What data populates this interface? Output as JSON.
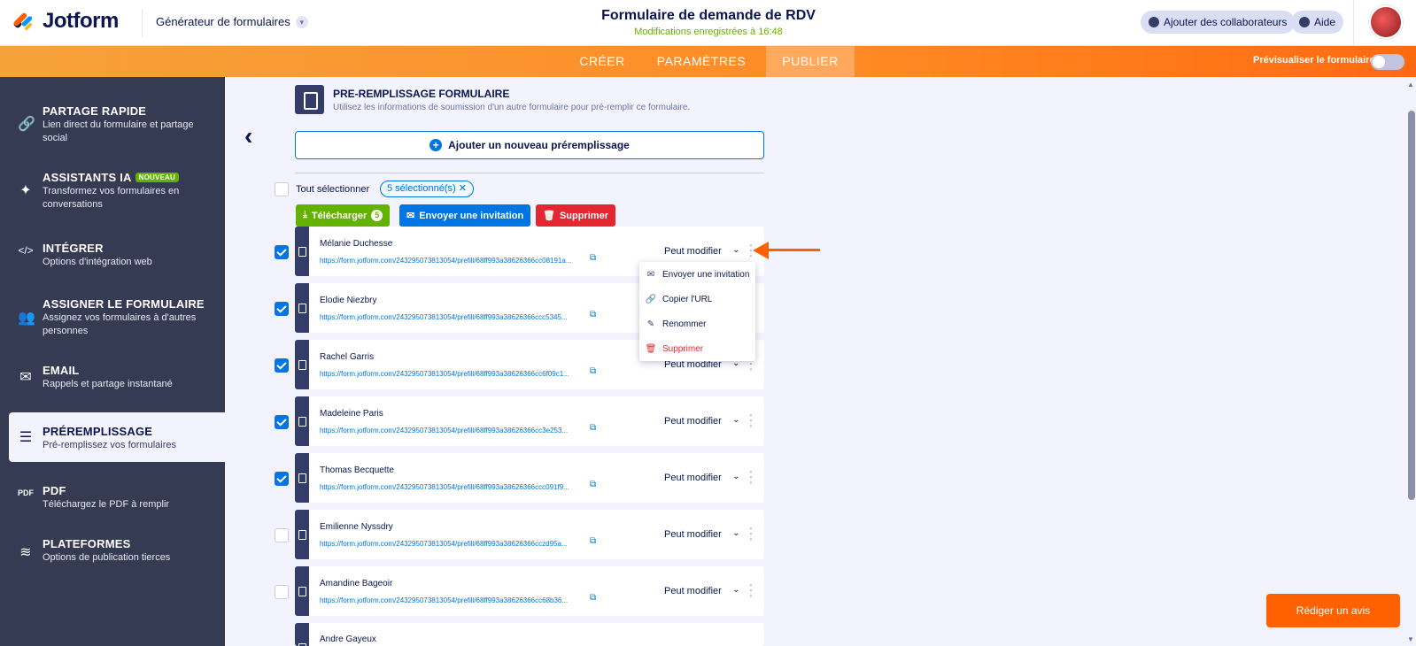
{
  "header": {
    "brand": "Jotform",
    "builder": "Générateur de formulaires",
    "form_title": "Formulaire de demande de RDV",
    "saved_status": "Modifications enregistrées à 16:48",
    "collab_label": "Ajouter des collaborateurs",
    "help_label": "Aide"
  },
  "nav": {
    "tabs": [
      {
        "label": "CRÉER"
      },
      {
        "label": "PARAMÈTRES"
      },
      {
        "label": "PUBLIER"
      }
    ],
    "preview_label": "Prévisualiser le formulaire"
  },
  "sidebar": {
    "items": [
      {
        "title": "PARTAGE RAPIDE",
        "desc": "Lien direct du formulaire et partage social"
      },
      {
        "title": "ASSISTANTS IA",
        "badge": "NOUVEAU",
        "desc": "Transformez vos formulaires en conversations"
      },
      {
        "title": "INTÉGRER",
        "desc": "Options d'intégration web"
      },
      {
        "title": "ASSIGNER LE FORMULAIRE",
        "desc": "Assignez vos formulaires à d'autres personnes"
      },
      {
        "title": "EMAIL",
        "desc": "Rappels et partage instantané"
      },
      {
        "title": "PRÉREMPLISSAGE",
        "desc": "Pré-remplissez vos formulaires"
      },
      {
        "title": "PDF",
        "desc": "Téléchargez le PDF à remplir"
      },
      {
        "title": "PLATEFORMES",
        "desc": "Options de publication tierces"
      }
    ]
  },
  "main": {
    "section_title": "PRE-REMPLISSAGE FORMULAIRE",
    "section_sub": "Utilisez les informations de soumission d'un autre formulaire pour pré-remplir ce formulaire.",
    "add_label": "Ajouter un nouveau préremplissage",
    "select_all": "Tout sélectionner",
    "selected_chip": "5 sélectionné(s)",
    "actions": {
      "download": "Télécharger",
      "download_count": "5",
      "invite": "Envoyer une invitation",
      "delete": "Supprimer"
    },
    "rows": [
      {
        "name": "Mélanie Duchesse",
        "url": "https://form.jotform.com/243295073813054/prefill/68ff993a38626366cc08191a...",
        "perm": "Peut modifier",
        "checked": true
      },
      {
        "name": "Elodie Niezbry",
        "url": "https://form.jotform.com/243295073813054/prefill/68ff993a38626366ccc5345...",
        "perm": "Peut modifier",
        "checked": true
      },
      {
        "name": "Rachel Garris",
        "url": "https://form.jotform.com/243295073813054/prefill/68ff993a38626366cc6f09c1...",
        "perm": "Peut modifier",
        "checked": true
      },
      {
        "name": "Madeleine Paris",
        "url": "https://form.jotform.com/243295073813054/prefill/68ff993a38626366cc3e253...",
        "perm": "Peut modifier",
        "checked": true
      },
      {
        "name": "Thomas Becquette",
        "url": "https://form.jotform.com/243295073813054/prefill/68ff993a38626366ccc091f9...",
        "perm": "Peut modifier",
        "checked": true
      },
      {
        "name": "Emilienne Nyssdry",
        "url": "https://form.jotform.com/243295073813054/prefill/68ff993a38626366cczd95a...",
        "perm": "Peut modifier",
        "checked": false
      },
      {
        "name": "Amandine Bageoir",
        "url": "https://form.jotform.com/243295073813054/prefill/68ff993a38626366cc68b36...",
        "perm": "Peut modifier",
        "checked": false
      },
      {
        "name": "Andre Gayeux",
        "url": "",
        "perm": "",
        "checked": false
      }
    ],
    "menu": [
      {
        "label": "Envoyer une invitation",
        "icon": "mail-icon"
      },
      {
        "label": "Copier l'URL",
        "icon": "link-icon"
      },
      {
        "label": "Renommer",
        "icon": "rename-icon"
      },
      {
        "label": "Supprimer",
        "icon": "trash-icon"
      }
    ],
    "review_label": "Rédiger un avis"
  },
  "colors": {
    "accent_orange": "#ff6100",
    "primary_blue": "#0075e3",
    "success_green": "#64b200",
    "danger_red": "#e3262f",
    "sidebar_bg": "#343b52"
  }
}
